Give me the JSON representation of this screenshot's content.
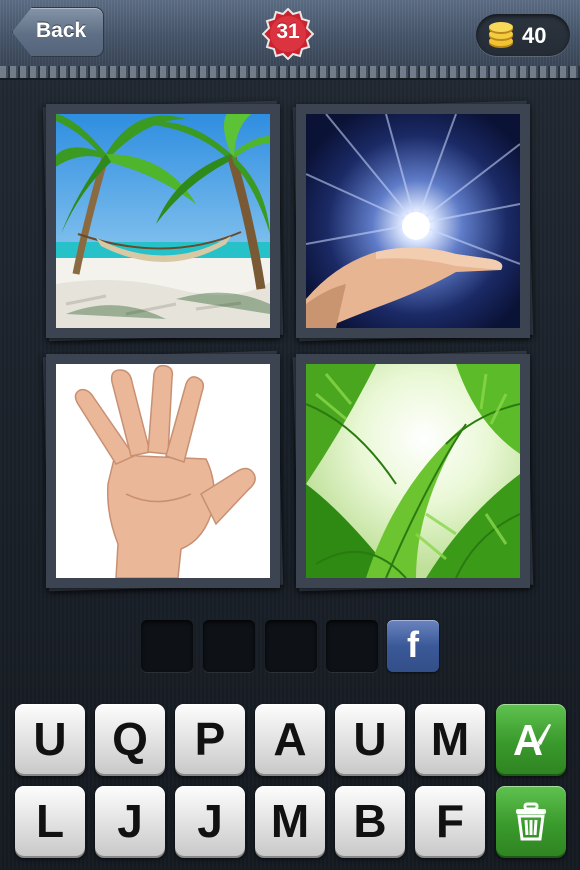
{
  "header": {
    "back_label": "Back",
    "level": "31",
    "coins": "40"
  },
  "pictures": [
    {
      "subject": "palm-trees-hammock-beach"
    },
    {
      "subject": "hand-holding-light"
    },
    {
      "subject": "open-hand-palm"
    },
    {
      "subject": "palm-leaves-sky"
    }
  ],
  "answer": {
    "slots": [
      "",
      "",
      "",
      ""
    ],
    "share_label": "f"
  },
  "keyboard": {
    "row1": [
      "U",
      "Q",
      "P",
      "A",
      "U",
      "M"
    ],
    "row2": [
      "L",
      "J",
      "J",
      "M",
      "B",
      "F"
    ]
  },
  "colors": {
    "badge_red": "#d42a35",
    "tool_green": "#3a9a2c",
    "facebook_blue": "#3b5998"
  },
  "icons": {
    "hint": "reveal-letter-icon",
    "remove": "trash-icon"
  }
}
